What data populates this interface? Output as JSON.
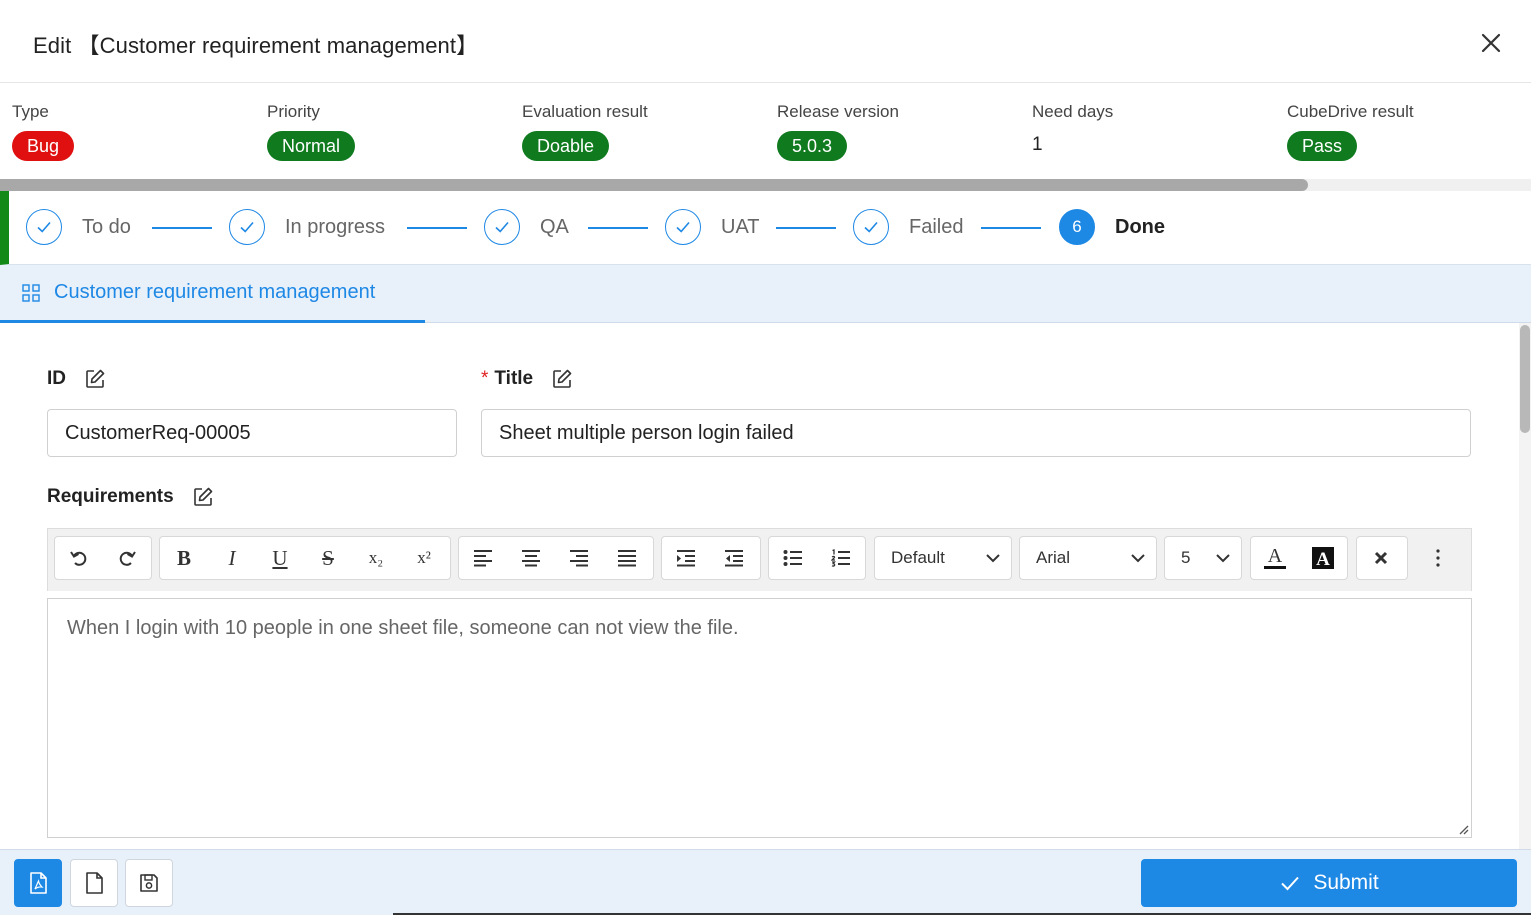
{
  "dialog": {
    "title": "Edit 【Customer requirement management】"
  },
  "summary": {
    "type": {
      "label": "Type",
      "value": "Bug",
      "color": "#e01010"
    },
    "priority": {
      "label": "Priority",
      "value": "Normal",
      "color": "#0f7a1e"
    },
    "evaluation": {
      "label": "Evaluation result",
      "value": "Doable",
      "color": "#0f7a1e"
    },
    "release": {
      "label": "Release version",
      "value": "5.0.3",
      "color": "#0f7a1e"
    },
    "need_days": {
      "label": "Need days",
      "value": "1"
    },
    "cubedrive": {
      "label": "CubeDrive result",
      "value": "Pass",
      "color": "#0f7a1e"
    }
  },
  "steps": [
    {
      "label": "To do",
      "state": "done"
    },
    {
      "label": "In progress",
      "state": "done"
    },
    {
      "label": "QA",
      "state": "done"
    },
    {
      "label": "UAT",
      "state": "done"
    },
    {
      "label": "Failed",
      "state": "done"
    },
    {
      "label": "Done",
      "state": "current",
      "number": "6"
    }
  ],
  "tabs": [
    {
      "label": "Customer requirement management",
      "active": true
    }
  ],
  "form": {
    "id": {
      "label": "ID",
      "value": "CustomerReq-00005"
    },
    "title": {
      "label": "Title",
      "required_mark": "*",
      "value": "Sheet multiple person login failed"
    },
    "requirements": {
      "label": "Requirements",
      "text": "When I login with 10 people in one sheet file, someone can not view the file."
    }
  },
  "editor_toolbar": {
    "format": "Default",
    "font": "Arial",
    "size": "5",
    "subscript_glyph": "x₂",
    "superscript_glyph": "x²"
  },
  "footer": {
    "submit_label": "Submit"
  },
  "colors": {
    "accent": "#1e88e5",
    "success": "#0f7a1e",
    "danger": "#e01010"
  }
}
